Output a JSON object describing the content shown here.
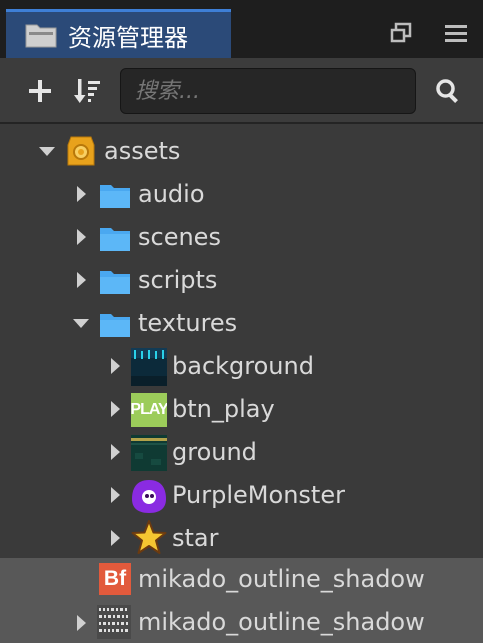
{
  "panel": {
    "title": "资源管理器"
  },
  "toolbar": {
    "search_placeholder": "搜索..."
  },
  "tree": [
    {
      "label": "assets",
      "depth": 0,
      "expanded": true,
      "icon": "database-icon"
    },
    {
      "label": "audio",
      "depth": 1,
      "expanded": false,
      "icon": "folder-icon"
    },
    {
      "label": "scenes",
      "depth": 1,
      "expanded": false,
      "icon": "folder-icon"
    },
    {
      "label": "scripts",
      "depth": 1,
      "expanded": false,
      "icon": "folder-icon"
    },
    {
      "label": "textures",
      "depth": 1,
      "expanded": true,
      "icon": "folder-icon"
    },
    {
      "label": "background",
      "depth": 2,
      "expanded": false,
      "icon": "background-thumb-icon"
    },
    {
      "label": "btn_play",
      "depth": 2,
      "expanded": false,
      "icon": "btn-play-thumb-icon"
    },
    {
      "label": "ground",
      "depth": 2,
      "expanded": false,
      "icon": "ground-thumb-icon"
    },
    {
      "label": "PurpleMonster",
      "depth": 2,
      "expanded": false,
      "icon": "purple-monster-thumb-icon"
    },
    {
      "label": "star",
      "depth": 2,
      "expanded": false,
      "icon": "star-thumb-icon"
    },
    {
      "label": "mikado_outline_shadow",
      "depth": 1,
      "expanded": null,
      "icon": "bitmap-font-icon",
      "selected": true
    },
    {
      "label": "mikado_outline_shadow",
      "depth": 1,
      "expanded": false,
      "icon": "font-atlas-thumb-icon",
      "selected": true
    }
  ],
  "thumb_text": {
    "btn_play": "PLAY",
    "bitmap_font": "Bf"
  },
  "colors": {
    "folder": "#4aa8f0",
    "tab_active": "#2b4a78",
    "selection": "#585858",
    "monster": "#8a2be2",
    "play_green": "#9ccc5a"
  }
}
